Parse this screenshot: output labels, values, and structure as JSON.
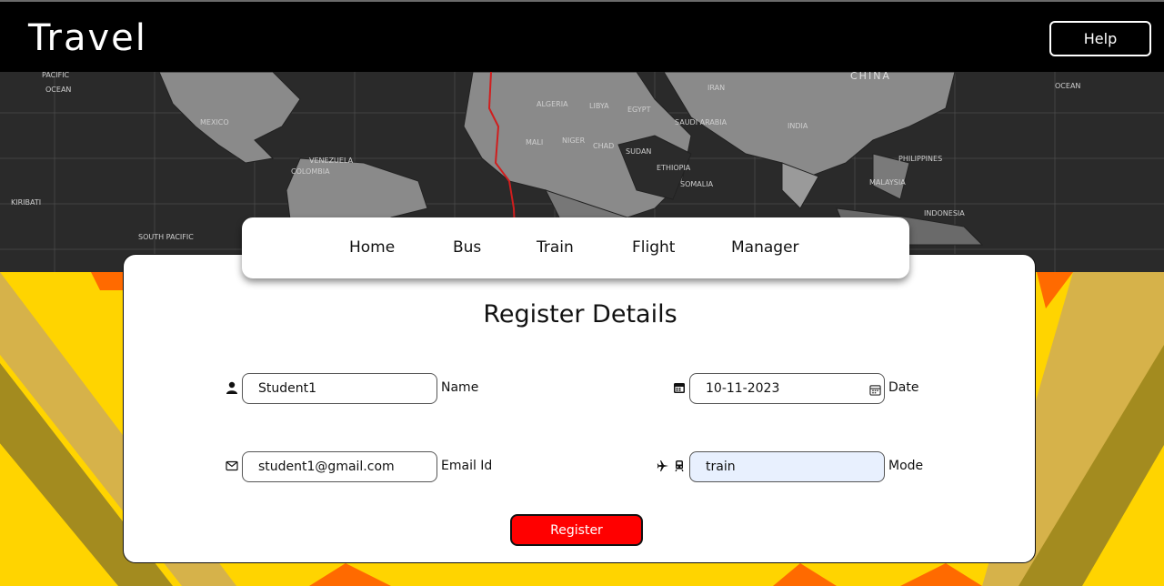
{
  "header": {
    "brand": "Travel",
    "help_label": "Help"
  },
  "nav": {
    "items": [
      {
        "label": "Home"
      },
      {
        "label": "Bus"
      },
      {
        "label": "Train"
      },
      {
        "label": "Flight"
      },
      {
        "label": "Manager"
      }
    ]
  },
  "map_labels": {
    "pacific_ocean": "PACIFIC\nOCEAN",
    "mexico": "MEXICO",
    "algeria": "ALGERIA",
    "libya": "LIBYA",
    "egypt": "EGYPT",
    "niger": "NIGER",
    "chad": "CHAD",
    "sudan": "SUDAN",
    "ethiopia": "ETHIOPIA",
    "mali": "MALI",
    "china": "CHINA",
    "india": "INDIA",
    "iran": "IRAN",
    "saudi_arabia": "SAUDI ARABIA",
    "philippines": "PHILIPPINES",
    "indonesia": "INDONESIA",
    "ocean": "OCEAN",
    "south_pacific": "SOUTH PACIFIC",
    "malaysia": "MALAYSIA",
    "somalia": "SOMALIA",
    "colombia": "COLOMBIA",
    "venezuela": "VENEZUELA",
    "kiribati": "KIRIBATI"
  },
  "form": {
    "title": "Register Details",
    "name": {
      "value": "Student1",
      "label": "Name"
    },
    "date": {
      "value": "10-11-2023",
      "label": "Date"
    },
    "email": {
      "value": "student1@gmail.com",
      "label": "Email Id"
    },
    "mode": {
      "value": "train",
      "label": "Mode"
    },
    "register_label": "Register"
  },
  "colors": {
    "header_bg": "#000000",
    "accent_red": "#ff0000",
    "stripe_yellow": "#ffd400",
    "stripe_orange": "#ff6a00",
    "stripe_olive": "#a38b1f",
    "mode_input_bg": "#e8f0fe"
  }
}
